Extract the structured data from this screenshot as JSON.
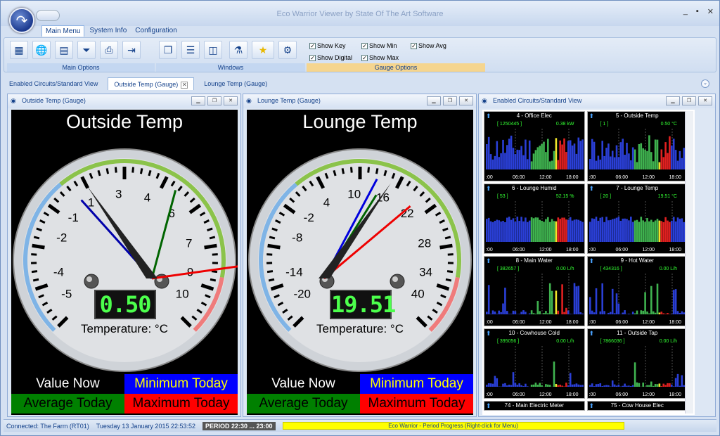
{
  "window": {
    "title": "Eco Warrior Viewer by State Of The Art Software",
    "minimize": "_",
    "maximize": "▪",
    "close": "✕"
  },
  "ribbon": {
    "tabs": [
      "Main Menu",
      "System Info",
      "Configuration"
    ],
    "groups": {
      "main_options": "Main Options",
      "windows": "Windows",
      "gauge_options": "Gauge Options"
    },
    "checks": [
      {
        "label": "Show Key",
        "checked": true
      },
      {
        "label": "Show Min",
        "checked": true
      },
      {
        "label": "Show Avg",
        "checked": true
      },
      {
        "label": "Show Digital",
        "checked": true
      },
      {
        "label": "Show Max",
        "checked": true
      }
    ]
  },
  "doc_tabs": [
    "Enabled Circuits/Standard View",
    "Outside Temp (Gauge)",
    "Lounge Temp (Gauge)"
  ],
  "panels": {
    "outside": {
      "title": "Outside Temp (Gauge)",
      "heading": "Outside Temp",
      "digital": "0.50",
      "caption": "Temperature: °C",
      "scale": [
        "-5",
        "-4",
        "-2",
        "-1",
        "1",
        "3",
        "4",
        "6",
        "7",
        "9",
        "10"
      ]
    },
    "lounge": {
      "title": "Lounge Temp (Gauge)",
      "heading": "Lounge Temp",
      "digital": "19.51",
      "caption": "Temperature: °C",
      "scale": [
        "-20",
        "-14",
        "-8",
        "-2",
        "4",
        "10",
        "16",
        "22",
        "28",
        "34",
        "40"
      ]
    },
    "legend": {
      "now": "Value Now",
      "min": "Minimum Today",
      "avg": "Average Today",
      "max": "Maximum Today"
    },
    "circuits": {
      "title": "Enabled Circuits/Standard View"
    }
  },
  "circuits": [
    {
      "name": "4 - Office Elec",
      "id": "[ 1250445 ]",
      "value": "0.38 kW"
    },
    {
      "name": "5 - Outside Temp",
      "id": "[ 1 ]",
      "value": "0.50 °C"
    },
    {
      "name": "6 - Lounge Humid",
      "id": "[ 53 ]",
      "value": "52.15 %"
    },
    {
      "name": "7 - Lounge Temp",
      "id": "[ 20 ]",
      "value": "19.51 °C"
    },
    {
      "name": "8 - Main Water",
      "id": "[ 382657 ]",
      "value": "0.00 L/h"
    },
    {
      "name": "9 - Hot Water",
      "id": "[ 434316 ]",
      "value": "0.00 L/h"
    },
    {
      "name": "10 - Cowhouse Cold",
      "id": "[ 395056 ]",
      "value": "0.00 L/h"
    },
    {
      "name": "11 - Outside Tap",
      "id": "[ 7866036 ]",
      "value": "0.00 L/h"
    },
    {
      "name": "74 - Main Electric Meter",
      "id": "",
      "value": ""
    },
    {
      "name": "75 - Cow House Elec",
      "id": "",
      "value": ""
    }
  ],
  "xticks": [
    ":00",
    "06:00",
    "12:00",
    "18:00"
  ],
  "status": {
    "connected": "Connected: The Farm (RT01)",
    "datetime": "Tuesday 13 January 2015 22:53:52",
    "period": "PERIOD 22:30 ... 23:00",
    "progress": "Eco Warrior - Period Progress (Right-click for Menu)"
  }
}
